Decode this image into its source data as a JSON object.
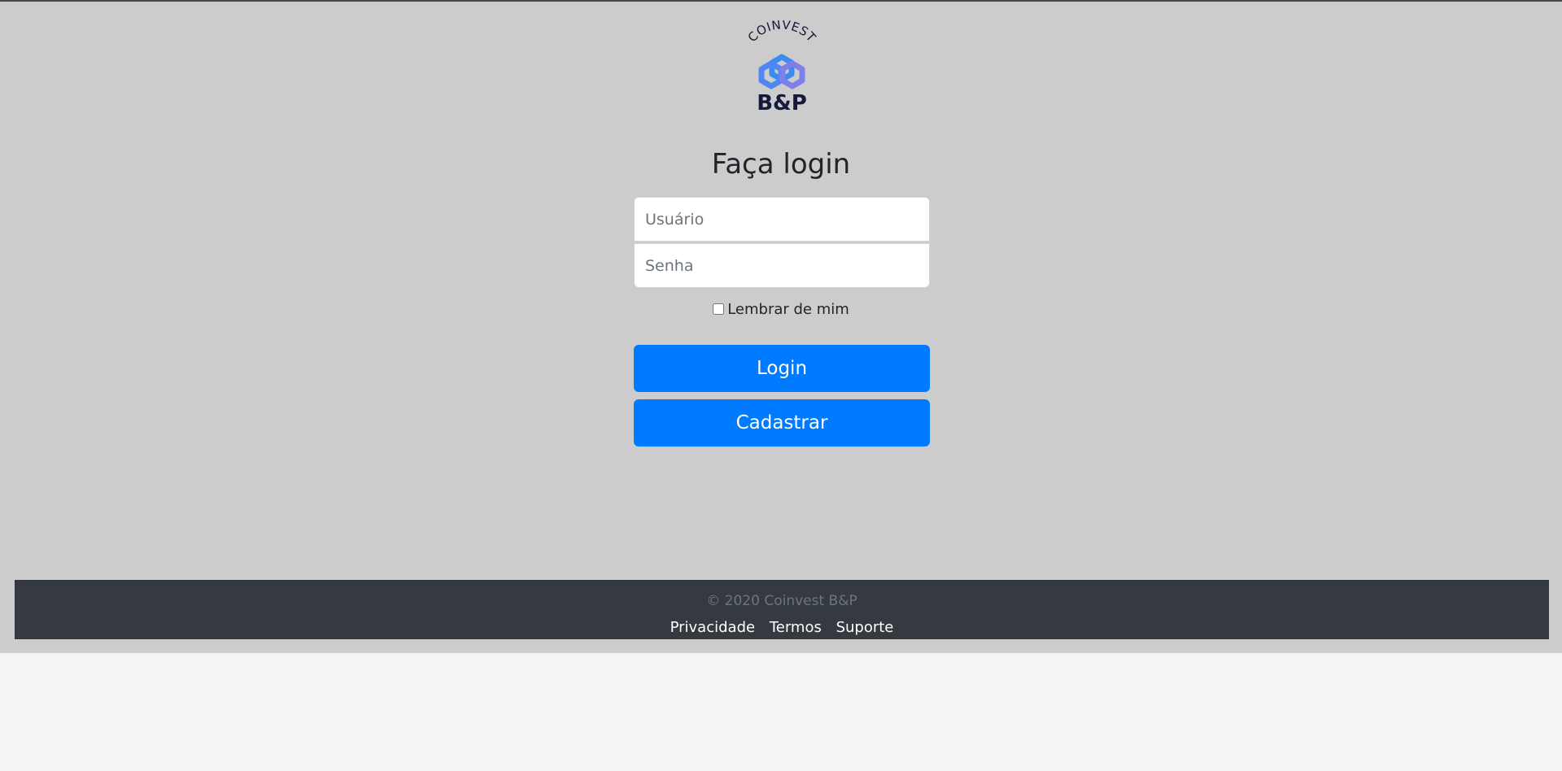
{
  "brand": {
    "logo_top_text": "COINVEST",
    "logo_bottom_text": "B&P",
    "colors": {
      "hex_blue": "#3b8cf0",
      "hex_purple": "#7f7fe8",
      "wordmark": "#15193a"
    }
  },
  "login": {
    "title": "Faça login",
    "username_placeholder": "Usuário",
    "password_placeholder": "Senha",
    "remember_label": "Lembrar de mim",
    "remember_checked": false,
    "login_button": "Login",
    "register_button": "Cadastrar"
  },
  "footer": {
    "copyright": "© 2020 Coinvest B&P",
    "links": [
      "Privacidade",
      "Termos",
      "Suporte"
    ]
  },
  "colors": {
    "page_background": "#cccccc",
    "primary": "#007bff",
    "footer_background": "#343a40"
  }
}
